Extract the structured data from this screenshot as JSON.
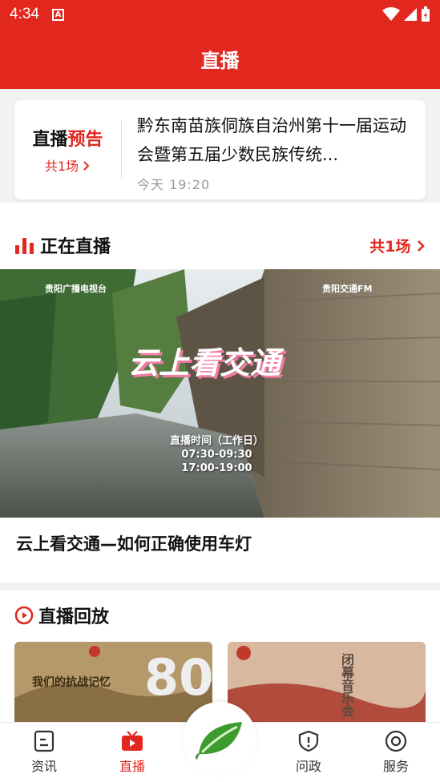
{
  "status_bar": {
    "time": "4:34"
  },
  "app_bar": {
    "title": "直播"
  },
  "preview": {
    "label_black": "直播",
    "label_red": "预告",
    "count_text": "共1场",
    "title": "黔东南苗族侗族自治州第十一届运动会暨第五届少数民族传统...",
    "time": "今天  19:20"
  },
  "live_now": {
    "section_title": "正在直播",
    "more_text": "共1场",
    "image_text": {
      "logo_left": "贵阳广播电视台",
      "logo_right": "贵阳交通FM",
      "headline": "云上看交通",
      "schedule_title": "直播时间（工作日）",
      "schedule_1": "07:30-09:30",
      "schedule_2": "17:00-19:00"
    },
    "item_title": "云上看交通—如何正确使用车灯"
  },
  "replay": {
    "section_title": "直播回放",
    "thumb1_text": "我们的抗战记忆",
    "thumb1_big": "80",
    "thumb2_text": "闭幕音乐会"
  },
  "tabs": [
    {
      "label": "资讯",
      "active": false
    },
    {
      "label": "直播",
      "active": true
    },
    {
      "label": "",
      "active": false
    },
    {
      "label": "问政",
      "active": false
    },
    {
      "label": "服务",
      "active": false
    }
  ],
  "colors": {
    "brand_red": "#e2271f"
  }
}
